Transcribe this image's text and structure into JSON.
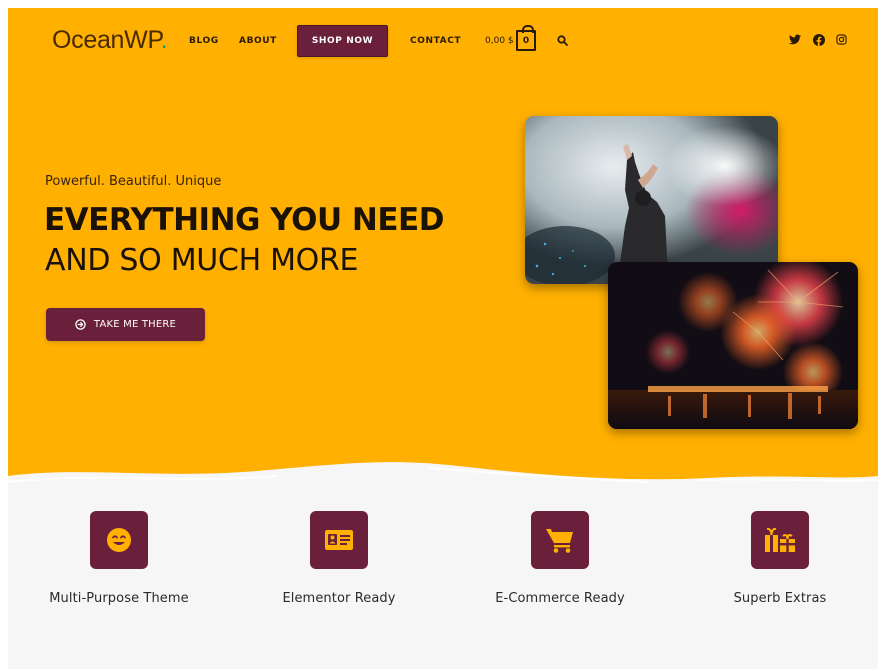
{
  "header": {
    "logo_text": "OceanWP",
    "logo_dot": ".",
    "nav": {
      "blog": "BLOG",
      "about": "ABOUT",
      "shop_now": "SHOP NOW",
      "contact": "CONTACT"
    },
    "cart_total": "0,00 $",
    "cart_count": "0",
    "icons": [
      "search-icon",
      "twitter-icon",
      "facebook-icon",
      "instagram-icon"
    ]
  },
  "hero": {
    "tagline": "Powerful. Beautiful. Unique",
    "headline": "EVERYTHING YOU NEED",
    "subheadline": "AND SO MUCH MORE",
    "cta_label": "TAKE ME THERE",
    "cta_icon": "arrow-circle-right-icon",
    "images": [
      "concert-photo",
      "fireworks-photo"
    ]
  },
  "features": [
    {
      "icon": "smiley-icon",
      "label": "Multi-Purpose Theme"
    },
    {
      "icon": "id-card-icon",
      "label": "Elementor Ready"
    },
    {
      "icon": "shopping-cart-icon",
      "label": "E-Commerce Ready"
    },
    {
      "icon": "gifts-icon",
      "label": "Superb Extras"
    }
  ],
  "colors": {
    "hero_background": "#ffb000",
    "accent": "#6a1f3a",
    "page_background": "#f6f6f6"
  }
}
